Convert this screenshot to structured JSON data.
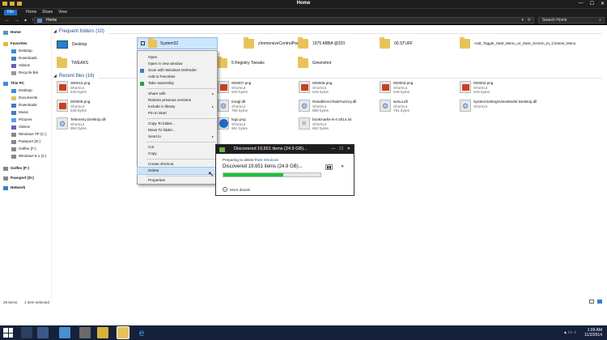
{
  "window": {
    "title": "Home",
    "controls": {
      "minimize": "—",
      "maximize": "☐",
      "close": "✕"
    }
  },
  "ribbon": {
    "tabs": [
      "File",
      "Home",
      "Share",
      "View"
    ]
  },
  "address": {
    "path": "Home",
    "search_placeholder": "Search Home",
    "nav_back": "←",
    "nav_forward": "→",
    "nav_up": "↑",
    "nav_recent": "▾",
    "dropdown": "▾",
    "refresh": "⟳",
    "search_icon": "⌕"
  },
  "sidebar": {
    "items": [
      {
        "label": "Home",
        "bold": true,
        "icon": "home-icon"
      },
      {
        "label": "Favorites",
        "bold": true,
        "icon": "star-icon"
      },
      {
        "label": "Desktop",
        "icon": "desktop-icon"
      },
      {
        "label": "Downloads",
        "icon": "download-icon"
      },
      {
        "label": "Videos",
        "icon": "video-icon"
      },
      {
        "label": "Recycle Bin",
        "icon": "recycle-icon"
      },
      {
        "label": "This PC",
        "bold": true,
        "icon": "computer-icon"
      },
      {
        "label": "Desktop",
        "icon": "desktop-icon"
      },
      {
        "label": "Documents",
        "icon": "documents-icon"
      },
      {
        "label": "Downloads",
        "icon": "download-icon"
      },
      {
        "label": "Music",
        "icon": "music-icon"
      },
      {
        "label": "Pictures",
        "icon": "pictures-icon"
      },
      {
        "label": "Videos",
        "icon": "video-icon"
      },
      {
        "label": "Windows TP (C:)",
        "icon": "drive-icon"
      },
      {
        "label": "Passport (D:)",
        "icon": "drive-icon"
      },
      {
        "label": "Golfex (F:)",
        "icon": "drive-icon"
      },
      {
        "label": "Windows 8.1 (J:)",
        "icon": "drive-icon"
      },
      {
        "label": "Golfex (F:)",
        "bold": true,
        "icon": "drive-icon"
      },
      {
        "label": "Passport (D:)",
        "bold": true,
        "icon": "drive-icon"
      },
      {
        "label": "Network",
        "bold": true,
        "icon": "network-icon"
      }
    ]
  },
  "frequent": {
    "header": "Frequent folders (10)",
    "folders": [
      {
        "name": "Desktop",
        "icon": "desktop-folder-icon"
      },
      {
        "name": "System32",
        "icon": "folder-icon"
      },
      {
        "name": "zImmersiveControlPanel",
        "icon": "folder-icon"
      },
      {
        "name": "1975 ABBA @320",
        "icon": "folder-icon"
      },
      {
        "name": "00.STUFF",
        "icon": "folder-icon"
      },
      {
        "name": "Add_Toggle_Start_Menu_or_Start_Screen_to_Context_Menu",
        "icon": "folder-icon"
      },
      {
        "name": "TWEAKS",
        "icon": "folder-icon"
      },
      {
        "name": "5 Registry Tweaks",
        "icon": "folder-icon"
      },
      {
        "name": "Greenshot",
        "icon": "folder-icon"
      }
    ]
  },
  "recent": {
    "header": "Recent files (16)",
    "files": [
      {
        "name": "000010.png",
        "type": "Shortcut",
        "size": "549 bytes",
        "thumb": "red"
      },
      {
        "name": "000007.png",
        "type": "Shortcut",
        "size": "549 bytes",
        "thumb": "red"
      },
      {
        "name": "000005.png",
        "type": "Shortcut",
        "size": "549 bytes",
        "thumb": "red"
      },
      {
        "name": "000003.png",
        "type": "Shortcut",
        "size": "549 bytes",
        "thumb": "red"
      },
      {
        "name": "000002.png",
        "type": "Shortcut",
        "size": "549 bytes",
        "thumb": "red"
      },
      {
        "name": "000006.png",
        "type": "Shortcut",
        "size": "549 bytes",
        "thumb": "red"
      },
      {
        "name": "Imagl.dll",
        "type": "Shortcut",
        "size": "786 bytes",
        "thumb": "gear"
      },
      {
        "name": "RetailDemoTaskFactory.dll",
        "type": "Shortcut",
        "size": "889 bytes",
        "thumb": "gear"
      },
      {
        "name": "twinui.dll",
        "type": "Shortcut",
        "size": "791 bytes",
        "thumb": "gear"
      },
      {
        "name": "SystemSettingsViewModel.Desktop.dll",
        "type": "Shortcut",
        "size": "",
        "thumb": "gear"
      },
      {
        "name": "Telemetry.Desktop.dll",
        "type": "Shortcut",
        "size": "954 bytes",
        "thumb": "gear"
      },
      {
        "name": "logo.png",
        "type": "Shortcut",
        "size": "961 bytes",
        "thumb": "blue"
      },
      {
        "name": "bookmarks-8-4-2014.txt",
        "type": "Shortcut",
        "size": "662 bytes",
        "thumb": "txt"
      }
    ]
  },
  "context_menu": {
    "items": [
      "Open",
      "Open in new window",
      "Scan with Windows Defender",
      "Add to Favorites",
      "Take ownership",
      "Share with",
      "Restore previous versions",
      "Include in library",
      "Pin to Start",
      "Copy To folder...",
      "Move To folder...",
      "Send to",
      "Cut",
      "Copy",
      "Create shortcut",
      "Delete",
      "Properties"
    ],
    "highlighted": "Delete",
    "submenu_arrow": "▸",
    "pointer": "↖"
  },
  "dialog": {
    "title": "Discovered 19,651 items (24.9 GB)...",
    "prep_text": "Preparing to delete from",
    "prep_link": "Windows",
    "status": "Discovered 19,651 items (24.9 GB)...",
    "progress": 0.62,
    "pause_glyph": "▮▮",
    "cancel_glyph": "✕",
    "more_details": "More details",
    "more_glyph": "⌄"
  },
  "status": {
    "items_count": "26 items",
    "selected": "1 item selected"
  },
  "taskbar": {
    "time": "1:09 AM",
    "date": "11/2/2014",
    "tray": "▴ ▭ ♪"
  },
  "colors": {
    "accent": "#1e6fc8",
    "progress": "#18c23a",
    "highlight": "#cfe3f7"
  }
}
